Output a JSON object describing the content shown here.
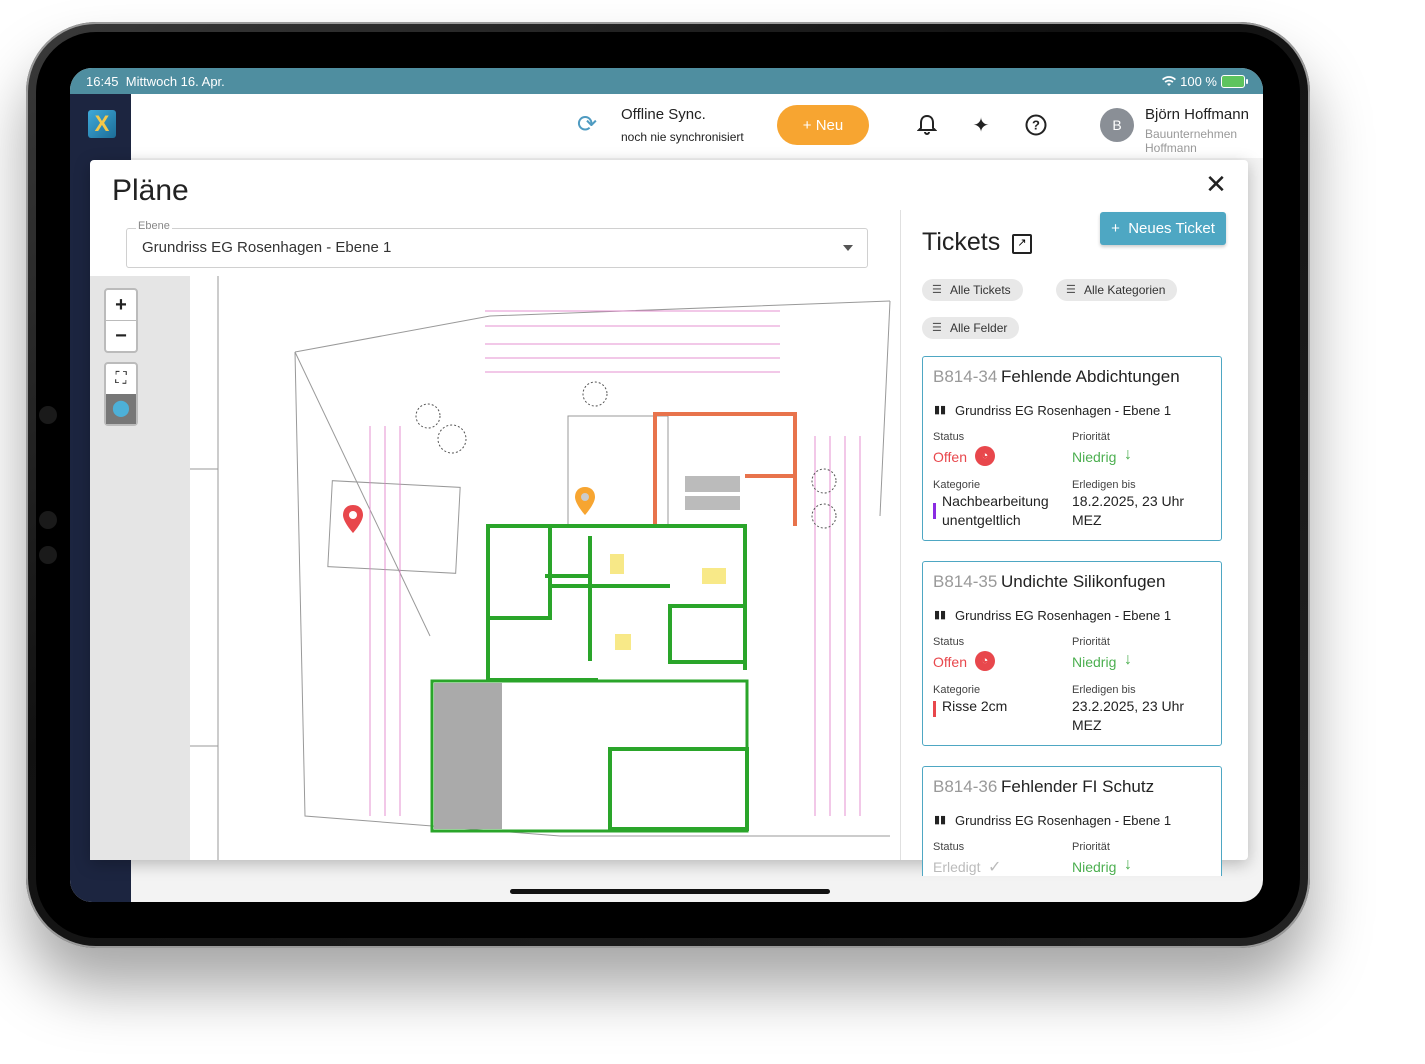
{
  "status_bar": {
    "time": "16:45",
    "date": "Mittwoch 16. Apr.",
    "wifi_icon": "wifi-icon",
    "battery": "100 %",
    "battery_icon": "battery-charging-icon"
  },
  "app": {
    "logo_letter": "X",
    "sync": {
      "icon": "sync-icon",
      "title": "Offline Sync.",
      "subtitle": "noch nie synchronisiert"
    },
    "new_button": "Neu",
    "icons": [
      "bell-icon",
      "sparkles-icon",
      "help-icon"
    ],
    "user": {
      "initial": "B",
      "name": "Björn Hoffmann",
      "company": "Bauunternehmen Hoffmann"
    },
    "colors": {
      "sidebar": "#1c2540",
      "accent": "#4ea7c3",
      "new_button": "#f7a531"
    }
  },
  "dialog": {
    "title": "Pläne",
    "close_icon": "close-icon",
    "ebene": {
      "label": "Ebene",
      "value": "Grundriss EG Rosenhagen - Ebene 1"
    },
    "map": {
      "zoom_in": "+",
      "zoom_out": "−",
      "tool_fit_icon": "fit-bounds-icon",
      "tool_pin_icon": "map-pin-icon",
      "pins": [
        {
          "color": "#e8474c",
          "icon": "map-pin-icon"
        },
        {
          "color": "#f7a531",
          "icon": "map-pin-icon"
        }
      ]
    },
    "tickets": {
      "title": "Tickets",
      "external_icon": "external-link-icon",
      "new_ticket": "Neues Ticket",
      "filters": [
        "Alle Tickets",
        "Alle Kategorien",
        "Alle Felder"
      ],
      "labels": {
        "status": "Status",
        "priority": "Priorität",
        "category": "Kategorie",
        "due": "Erledigen bis"
      },
      "items": [
        {
          "number": "B814-34",
          "title": "Fehlende Abdichtungen",
          "plan": "Grundriss EG Rosenhagen - Ebene 1",
          "status": "Offen",
          "priority": "Niedrig",
          "category_line1": "Nachbearbeitung",
          "category_line2": "unentgeltlich",
          "category_color": "#8a2be2",
          "due_line1": "18.2.2025, 23 Uhr",
          "due_line2": "MEZ"
        },
        {
          "number": "B814-35",
          "title": "Undichte Silikonfugen",
          "plan": "Grundriss EG Rosenhagen - Ebene 1",
          "status": "Offen",
          "priority": "Niedrig",
          "category_line1": "Risse 2cm",
          "category_line2": "",
          "category_color": "#e8474c",
          "due_line1": "23.2.2025, 23 Uhr",
          "due_line2": "MEZ"
        },
        {
          "number": "B814-36",
          "title": "Fehlender FI Schutz",
          "plan": "Grundriss EG Rosenhagen - Ebene 1",
          "status": "Erledigt",
          "priority": "Niedrig"
        }
      ]
    }
  }
}
